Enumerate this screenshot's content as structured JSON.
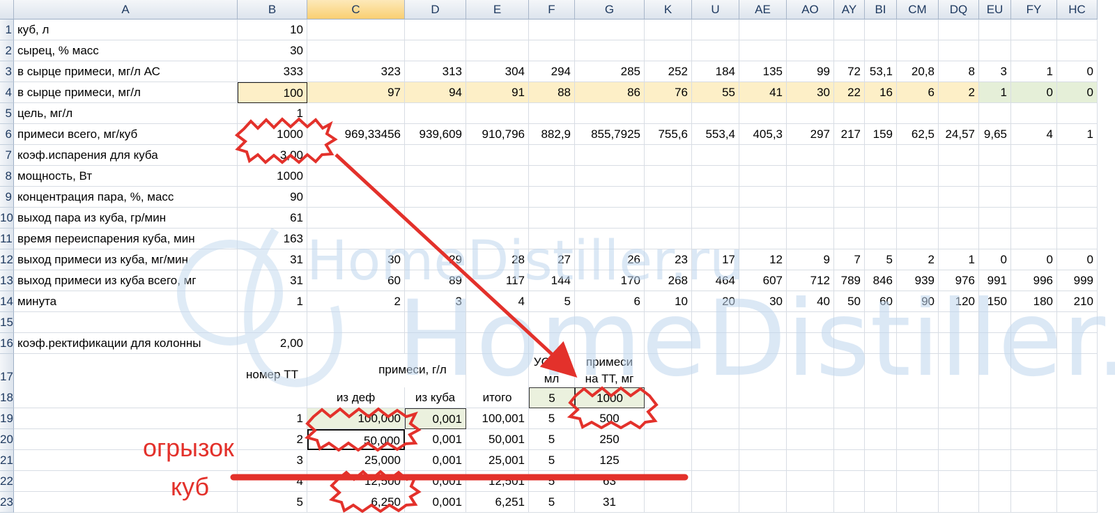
{
  "columns": [
    "A",
    "B",
    "C",
    "D",
    "E",
    "F",
    "G",
    "K",
    "U",
    "AE",
    "AO",
    "AY",
    "BI",
    "CM",
    "DQ",
    "EU",
    "FY",
    "HC"
  ],
  "rows": [
    {
      "n": "1",
      "a": "куб, л",
      "vals": [
        "10",
        "",
        "",
        "",
        "",
        "",
        "",
        "",
        "",
        "",
        "",
        "",
        "",
        "",
        "",
        "",
        ""
      ]
    },
    {
      "n": "2",
      "a": "сырец, % масс",
      "vals": [
        "30",
        "",
        "",
        "",
        "",
        "",
        "",
        "",
        "",
        "",
        "",
        "",
        "",
        "",
        "",
        "",
        ""
      ]
    },
    {
      "n": "3",
      "a": "в сырце примеси, мг/л АС",
      "vals": [
        "333",
        "323",
        "313",
        "304",
        "294",
        "285",
        "252",
        "184",
        "135",
        "99",
        "72",
        "53,1",
        "20,8",
        "8",
        "3",
        "1",
        "0"
      ]
    },
    {
      "n": "4",
      "a": "в сырце примеси, мг/л",
      "vals": [
        "100",
        "97",
        "94",
        "91",
        "88",
        "86",
        "76",
        "55",
        "41",
        "30",
        "22",
        "16",
        "6",
        "2",
        "1",
        "0",
        "0"
      ]
    },
    {
      "n": "5",
      "a": "цель, мг/л",
      "vals": [
        "1",
        "",
        "",
        "",
        "",
        "",
        "",
        "",
        "",
        "",
        "",
        "",
        "",
        "",
        "",
        "",
        ""
      ]
    },
    {
      "n": "6",
      "a": "примеси всего, мг/куб",
      "vals": [
        "1000",
        "969,33456",
        "939,609",
        "910,796",
        "882,9",
        "855,7925",
        "755,6",
        "553,4",
        "405,3",
        "297",
        "217",
        "159",
        "62,5",
        "24,57",
        "9,65",
        "4",
        "1"
      ]
    },
    {
      "n": "7",
      "a": "коэф.испарения для куба",
      "vals": [
        "3,00",
        "",
        "",
        "",
        "",
        "",
        "",
        "",
        "",
        "",
        "",
        "",
        "",
        "",
        "",
        "",
        ""
      ]
    },
    {
      "n": "8",
      "a": "мощность, Вт",
      "vals": [
        "1000",
        "",
        "",
        "",
        "",
        "",
        "",
        "",
        "",
        "",
        "",
        "",
        "",
        "",
        "",
        "",
        ""
      ]
    },
    {
      "n": "9",
      "a": "концентрация пара, %, масс",
      "vals": [
        "90",
        "",
        "",
        "",
        "",
        "",
        "",
        "",
        "",
        "",
        "",
        "",
        "",
        "",
        "",
        "",
        ""
      ]
    },
    {
      "n": "10",
      "a": "выход пара из куба, гр/мин",
      "vals": [
        "61",
        "",
        "",
        "",
        "",
        "",
        "",
        "",
        "",
        "",
        "",
        "",
        "",
        "",
        "",
        "",
        ""
      ]
    },
    {
      "n": "11",
      "a": "время переиспарения куба, мин",
      "vals": [
        "163",
        "",
        "",
        "",
        "",
        "",
        "",
        "",
        "",
        "",
        "",
        "",
        "",
        "",
        "",
        "",
        ""
      ]
    },
    {
      "n": "12",
      "a": "выход примеси из куба, мг/мин",
      "vals": [
        "31",
        "30",
        "29",
        "28",
        "27",
        "26",
        "23",
        "17",
        "12",
        "9",
        "7",
        "5",
        "2",
        "1",
        "0",
        "0",
        "0"
      ]
    },
    {
      "n": "13",
      "a": "выход примеси из куба всего, мг",
      "vals": [
        "31",
        "60",
        "89",
        "117",
        "144",
        "170",
        "268",
        "464",
        "607",
        "712",
        "789",
        "846",
        "939",
        "976",
        "991",
        "996",
        "999"
      ]
    },
    {
      "n": "14",
      "a": "минута",
      "vals": [
        "1",
        "2",
        "3",
        "4",
        "5",
        "6",
        "10",
        "20",
        "30",
        "40",
        "50",
        "60",
        "90",
        "120",
        "150",
        "180",
        "210"
      ]
    },
    {
      "n": "15",
      "a": "",
      "vals": [
        "",
        "",
        "",
        "",
        "",
        "",
        "",
        "",
        "",
        "",
        "",
        "",
        "",
        "",
        "",
        "",
        ""
      ]
    },
    {
      "n": "16",
      "a": "коэф.ректификации для колонны",
      "vals": [
        "2,00",
        "",
        "",
        "",
        "",
        "",
        "",
        "",
        "",
        "",
        "",
        "",
        "",
        "",
        "",
        "",
        ""
      ]
    }
  ],
  "tt": {
    "row17": {
      "n": "17",
      "b": "номер ТТ",
      "cd": "примеси, г/л",
      "f1": "УС ТТ,",
      "f2": "мл",
      "g1": "примеси",
      "g2": "на ТТ, мг"
    },
    "row18": {
      "n": "18",
      "c": "из деф",
      "d": "из куба",
      "e": "итого",
      "f": "5",
      "g": "1000"
    },
    "rows": [
      {
        "n": "19",
        "b": "1",
        "c": "100,000",
        "d": "0,001",
        "e": "100,001",
        "f": "5",
        "g": "500"
      },
      {
        "n": "20",
        "b": "2",
        "c": "50,000",
        "d": "0,001",
        "e": "50,001",
        "f": "5",
        "g": "250"
      },
      {
        "n": "21",
        "b": "3",
        "c": "25,000",
        "d": "0,001",
        "e": "25,001",
        "f": "5",
        "g": "125"
      },
      {
        "n": "22",
        "b": "4",
        "c": "12,500",
        "d": "0,001",
        "e": "12,501",
        "f": "5",
        "g": "63"
      },
      {
        "n": "23",
        "b": "5",
        "c": "6,250",
        "d": "0,001",
        "e": "6,251",
        "f": "5",
        "g": "31"
      }
    ]
  },
  "annotations": {
    "label1": "огрызок",
    "label2": "куб"
  },
  "watermark": {
    "small": "HomeDistiller.ru",
    "big": "HomeDistiller."
  },
  "colors": {
    "red_annotation": "#e3312b",
    "highlight_yellow": "#fdefc7",
    "highlight_green": "#e5efd8",
    "header_bg": "#dde4ed",
    "watermark": "#bfd6ee"
  }
}
